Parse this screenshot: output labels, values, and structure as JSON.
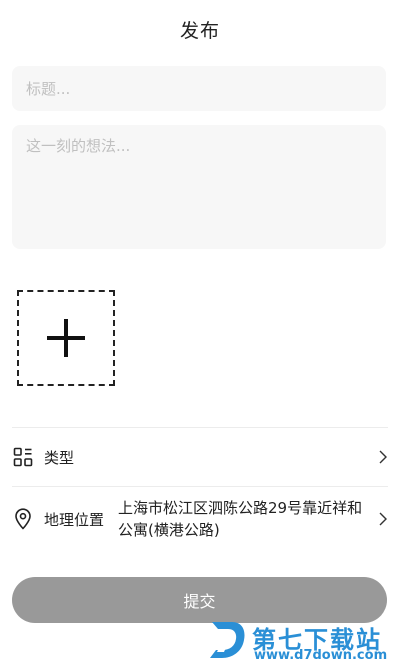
{
  "page": {
    "title": "发布"
  },
  "form": {
    "title_placeholder": "标题...",
    "content_placeholder": "这一刻的想法..."
  },
  "add_image": {
    "icon": "plus-icon"
  },
  "rows": {
    "type": {
      "icon": "category-grid-icon",
      "label": "类型",
      "chevron": "chevron-right-icon"
    },
    "location": {
      "icon": "location-pin-icon",
      "label": "地理位置",
      "value": "上海市松江区泗陈公路29号靠近祥和公寓(横港公路)",
      "chevron": "chevron-right-icon"
    }
  },
  "submit": {
    "label": "提交",
    "color": "#999999"
  },
  "watermark": {
    "title": "第七下载站",
    "url": "www.d7down.com",
    "color": "#2a8fd6"
  }
}
